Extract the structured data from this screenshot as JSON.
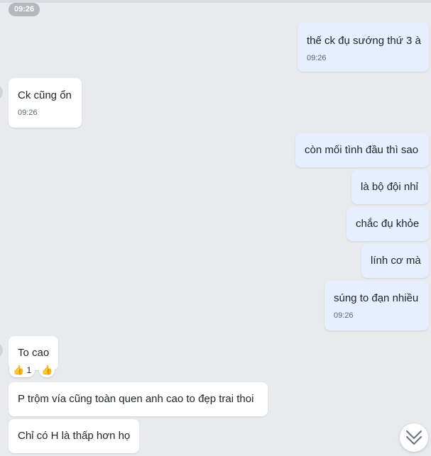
{
  "top_time": "09:26",
  "messages": [
    {
      "text": "thế ck đụ sướng thứ 3 à",
      "time": "09:26"
    },
    {
      "text": "Ck cũng ổn",
      "time": "09:26"
    },
    {
      "text": "còn mối tình đầu thì sao"
    },
    {
      "text": "là bộ đội nhỉ"
    },
    {
      "text": "chắc đụ khỏe"
    },
    {
      "text": "lính cơ mà"
    },
    {
      "text": "súng to đạn nhiều",
      "time": "09:26"
    },
    {
      "text": "To cao"
    },
    {
      "text": "P trộm vía cũng toàn quen anh cao to đẹp trai thoi"
    },
    {
      "text": "Chỉ có H là thấp hơn họ"
    }
  ],
  "reaction": {
    "icon": "👍",
    "count": "1",
    "add_icon": "👍"
  },
  "colors": {
    "background": "#e8eaee",
    "incoming": "#ffffff",
    "outgoing": "#e5efff",
    "pill": "#b3b7be"
  }
}
